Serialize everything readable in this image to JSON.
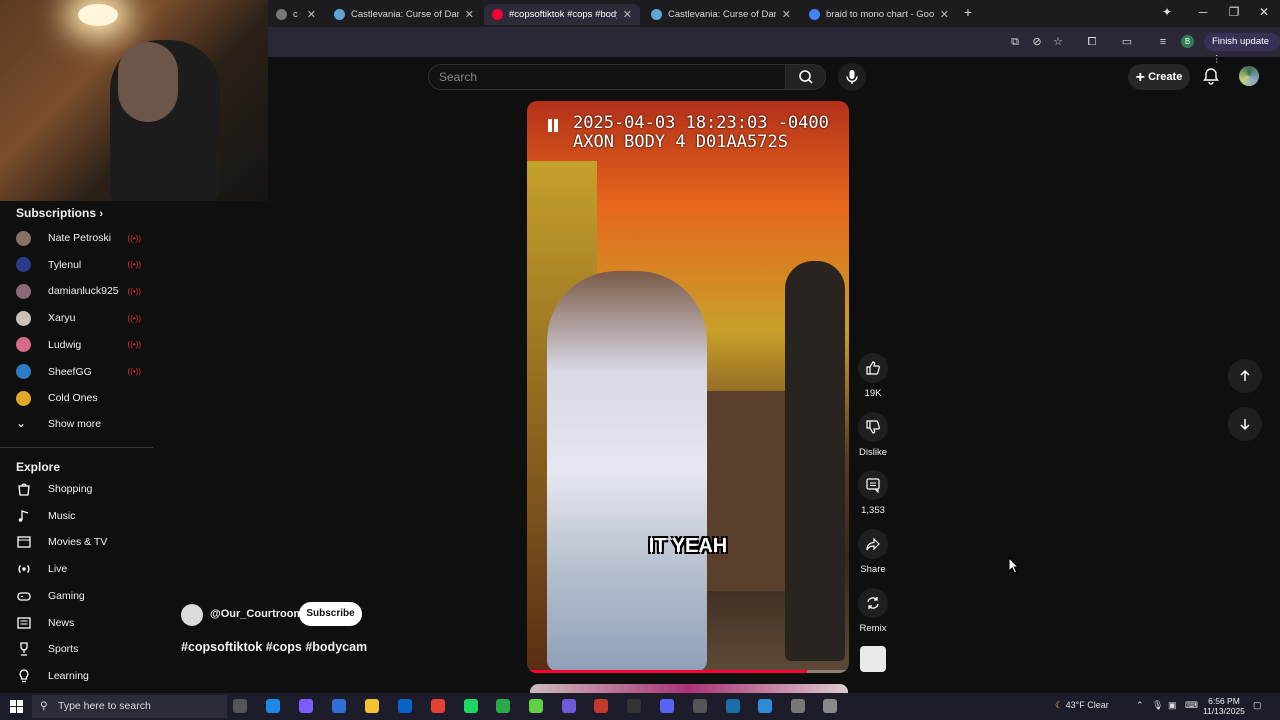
{
  "browser": {
    "tabs": [
      {
        "label": "c • Thur",
        "favicon_color": "#777777",
        "active": false
      },
      {
        "label": "Castlevania: Curse of Darkness",
        "favicon_color": "#5fa6d8",
        "active": false
      },
      {
        "label": "#copsoftiktok #cops #body",
        "favicon_color": "#ff0033",
        "active": true
      },
      {
        "label": "Castlevania: Curse of Darkness",
        "favicon_color": "#5fa6d8",
        "active": false
      },
      {
        "label": "braid to mono chart - Google S",
        "favicon_color": "#4285f4",
        "active": false
      }
    ],
    "new_tab": "+",
    "profile_letter": "B",
    "finish_update": "Finish update"
  },
  "youtube": {
    "search_placeholder": "Search",
    "create_label": "Create"
  },
  "sidebar": {
    "subscriptions_title": "Subscriptions",
    "subscriptions": [
      {
        "name": "Nate Petroski",
        "live": true,
        "color": "#8a7060"
      },
      {
        "name": "Tylenul",
        "live": true,
        "color": "#2a3b8c"
      },
      {
        "name": "damianluck925",
        "live": true,
        "color": "#8c6a78"
      },
      {
        "name": "Xaryu",
        "live": true,
        "color": "#c9c0b8"
      },
      {
        "name": "Ludwig",
        "live": true,
        "color": "#d66b8a"
      },
      {
        "name": "SheefGG",
        "live": true,
        "color": "#2c7bc4"
      },
      {
        "name": "Cold Ones",
        "live": false,
        "color": "#e0a829"
      }
    ],
    "show_more": "Show more",
    "explore_title": "Explore",
    "explore": [
      {
        "name": "Shopping",
        "icon": "shopping-bag-icon"
      },
      {
        "name": "Music",
        "icon": "music-note-icon"
      },
      {
        "name": "Movies & TV",
        "icon": "film-icon"
      },
      {
        "name": "Live",
        "icon": "live-broadcast-icon"
      },
      {
        "name": "Gaming",
        "icon": "gamepad-icon"
      },
      {
        "name": "News",
        "icon": "newspaper-icon"
      },
      {
        "name": "Sports",
        "icon": "trophy-icon"
      },
      {
        "name": "Learning",
        "icon": "lightbulb-icon"
      }
    ]
  },
  "video": {
    "timestamp_line1": "2025-04-03 18:23:03 -0400",
    "timestamp_line2": "AXON BODY 4 D01AA572S",
    "caption": "IT YEAH",
    "progress": 0.87
  },
  "actions": {
    "likes": "19K",
    "dislike": "Dislike",
    "comments": "1,353",
    "share": "Share",
    "remix": "Remix"
  },
  "channel": {
    "handle": "@Our_Courtroom",
    "subscribe": "Subscribe",
    "tags": "#copsoftiktok #cops #bodycam"
  },
  "taskbar": {
    "search_placeholder": "Type here to search",
    "weather": "43°F  Clear",
    "time": "6:56 PM",
    "date": "11/13/2025"
  }
}
